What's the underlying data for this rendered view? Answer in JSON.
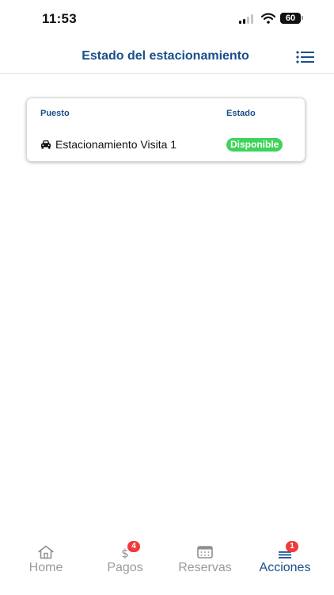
{
  "status_bar": {
    "time": "11:53",
    "battery": "60"
  },
  "header": {
    "title": "Estado del estacionamiento"
  },
  "table": {
    "columns": [
      "Puesto",
      "Estado"
    ],
    "rows": [
      {
        "puesto": "Estacionamiento Visita 1",
        "estado": "Disponible",
        "icon": "car-icon"
      }
    ]
  },
  "tabbar": {
    "items": [
      {
        "label": "Home",
        "icon": "home-icon",
        "badge": ""
      },
      {
        "label": "Pagos",
        "icon": "dollar-icon",
        "badge": "4"
      },
      {
        "label": "Reservas",
        "icon": "calendar-icon",
        "badge": ""
      },
      {
        "label": "Acciones",
        "icon": "list-icon",
        "badge": "1"
      }
    ],
    "active": "Acciones"
  },
  "colors": {
    "primary": "#1a4f8b",
    "available": "#3fd35a",
    "badge": "#ef3b3b",
    "inactive": "#9a9a9a"
  }
}
